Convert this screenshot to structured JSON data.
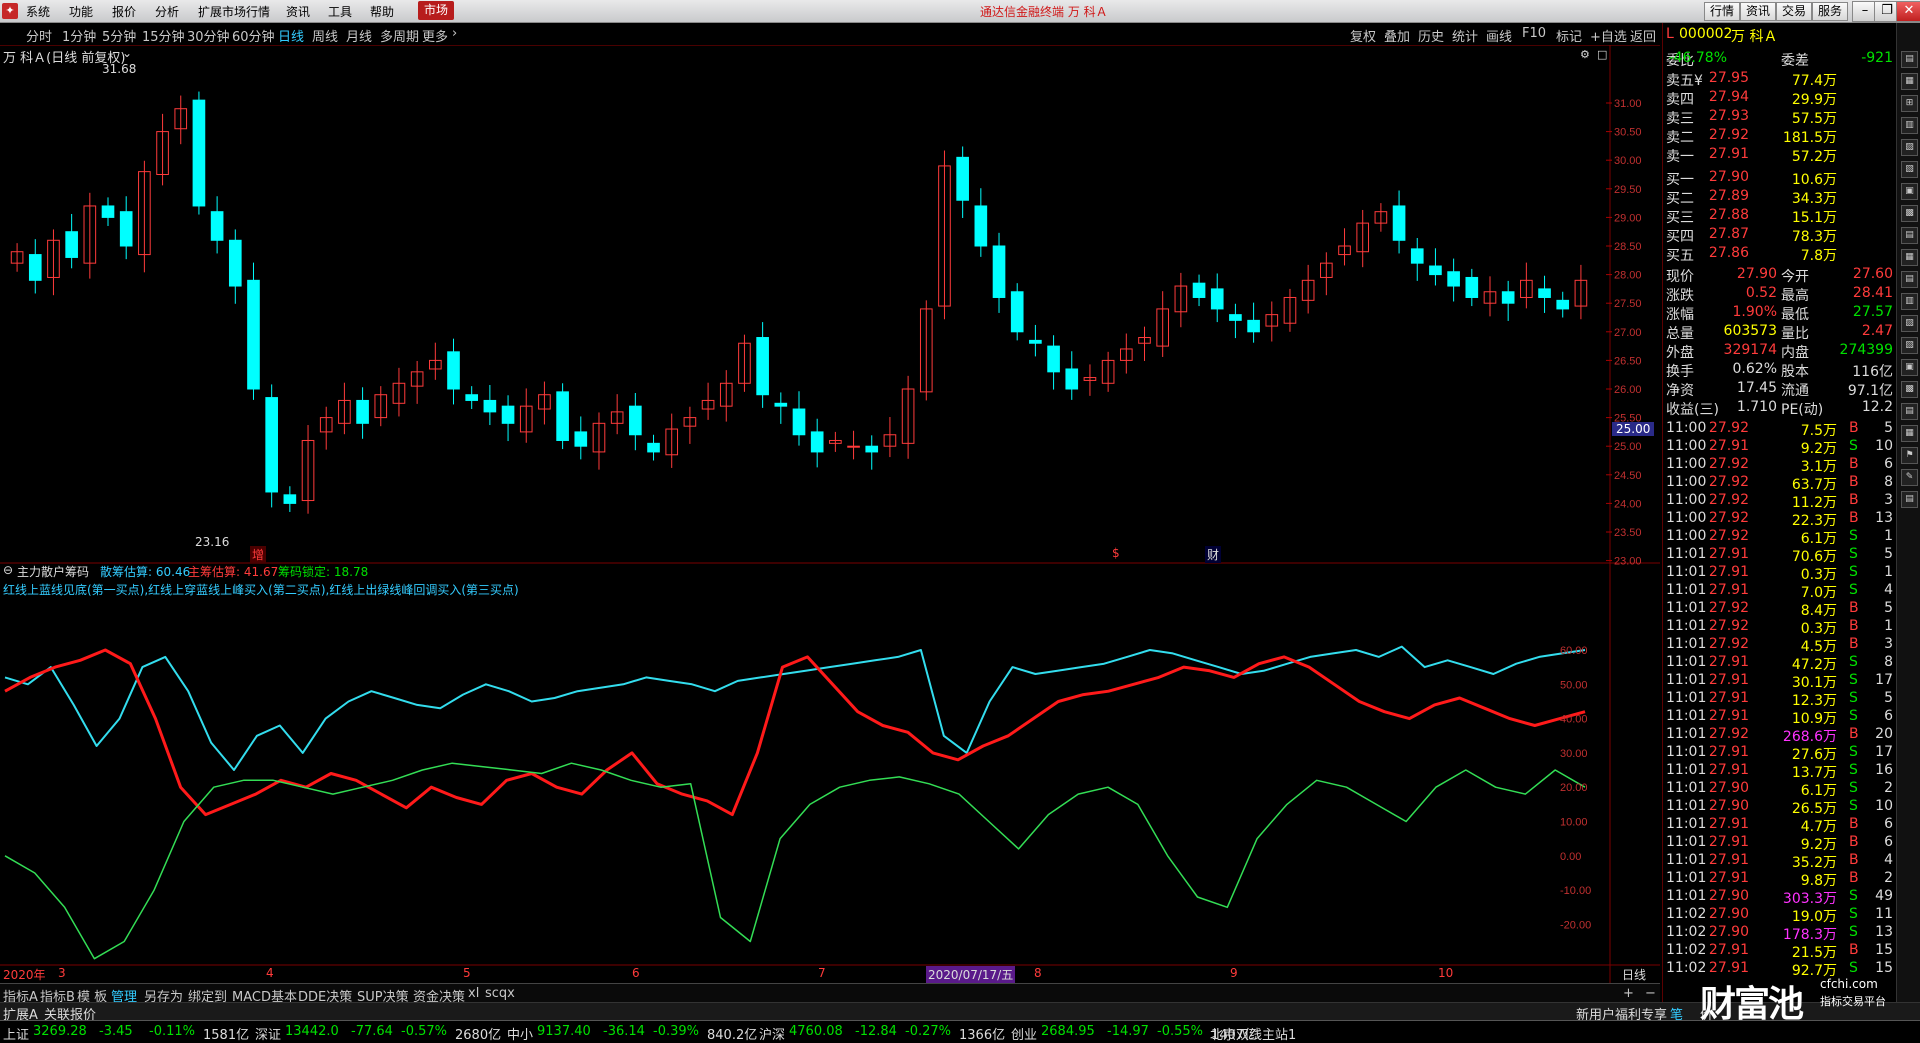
{
  "menu": {
    "items": [
      "系统",
      "功能",
      "报价",
      "分析",
      "扩展市场行情",
      "资讯",
      "工具",
      "帮助"
    ],
    "market": "市场",
    "app_title": "通达信金融终端 万 科Ａ",
    "top_buttons": [
      "行情",
      "资讯",
      "交易",
      "服务"
    ]
  },
  "periods": [
    "分时",
    "1分钟",
    "5分钟",
    "15分钟",
    "30分钟",
    "60分钟",
    "日线",
    "周线",
    "月线",
    "多周期",
    "更多"
  ],
  "active_period": "日线",
  "chart_tools": [
    "复权",
    "叠加",
    "历史",
    "统计",
    "画线",
    "F10",
    "标记",
    "+自选",
    "返回"
  ],
  "stock_title": "万 科Ａ(日线 前复权)",
  "price_chart": {
    "high_mark": "31.68",
    "low_mark": "23.16",
    "y_labels": [
      "31.00",
      "30.50",
      "30.00",
      "29.50",
      "29.00",
      "28.50",
      "28.00",
      "27.50",
      "27.00",
      "26.50",
      "26.00",
      "25.50",
      "25.00",
      "24.50",
      "24.00",
      "23.50",
      "23.00"
    ],
    "current_price_label": "25.00",
    "event_marks": [
      "增",
      "$",
      "财"
    ]
  },
  "indicator": {
    "name": "主力散户筹码",
    "retail_label": "散筹估算: 60.46",
    "main_label": "主筹估算: 41.67",
    "lock_label": "筹码锁定: 18.78",
    "note": "红线上蓝线见底(第一买点),红线上穿蓝线上峰买入(第二买点),红线上出绿线峰回调买入(第三买点)",
    "y_labels": [
      "60.00",
      "50.00",
      "40.00",
      "30.00",
      "20.00",
      "10.00",
      "0.00",
      "-10.00",
      "-20.00"
    ]
  },
  "x_axis": {
    "labels": [
      "2020年",
      "3",
      "4",
      "5",
      "6",
      "7",
      "8",
      "9",
      "10"
    ],
    "cursor_date": "2020/07/17/五",
    "scale_label": "日线"
  },
  "colors": {
    "up": "#ff3b3b",
    "down": "#00ffff",
    "retail_line": "#33ddee",
    "main_line": "#ff1a1a",
    "lock_line": "#33dd55"
  },
  "chart_data": [
    {
      "type": "candlestick",
      "title": "万 科Ａ(日线 前复权)",
      "ylim": [
        23.0,
        31.3
      ],
      "high": 31.68,
      "low": 23.16,
      "series": [
        {
          "name": "万 科Ａ",
          "values": [
            28.4,
            27.9,
            28.6,
            28.3,
            29.2,
            29.0,
            28.5,
            29.8,
            30.5,
            30.9,
            29.2,
            28.6,
            27.8,
            26.0,
            24.2,
            24.0,
            25.1,
            25.5,
            25.8,
            25.4,
            25.9,
            26.1,
            26.3,
            26.5,
            26.0,
            25.8,
            25.6,
            25.4,
            25.7,
            25.9,
            25.1,
            25.0,
            25.4,
            25.6,
            25.2,
            24.9,
            25.3,
            25.5,
            25.8,
            26.1,
            26.8,
            25.9,
            25.7,
            25.2,
            24.9,
            25.1,
            25.0,
            24.9,
            25.2,
            26.0,
            27.4,
            29.9,
            29.3,
            28.5,
            27.6,
            27.0,
            26.8,
            26.3,
            26.0,
            26.2,
            26.5,
            26.7,
            26.9,
            27.4,
            27.8,
            27.6,
            27.4,
            27.2,
            27.0,
            27.3,
            27.6,
            27.9,
            28.2,
            28.5,
            28.9,
            29.1,
            28.6,
            28.2,
            28.0,
            27.8,
            27.6,
            27.7,
            27.5,
            27.9,
            27.6,
            27.4,
            27.9
          ]
        }
      ]
    },
    {
      "type": "line",
      "title": "主力散户筹码",
      "ylim": [
        -35,
        65
      ],
      "series": [
        {
          "name": "散筹估算",
          "values": [
            52,
            50,
            55,
            44,
            32,
            40,
            55,
            58,
            48,
            33,
            25,
            35,
            38,
            30,
            40,
            45,
            48,
            46,
            44,
            43,
            47,
            50,
            48,
            45,
            46,
            48,
            49,
            50,
            52,
            51,
            50,
            48,
            51,
            52,
            53,
            54,
            55,
            56,
            57,
            58,
            60,
            35,
            30,
            45,
            55,
            53,
            54,
            55,
            56,
            58,
            60,
            59,
            57,
            55,
            53,
            54,
            56,
            58,
            59,
            60,
            58,
            61,
            55,
            57,
            55,
            53,
            56,
            58,
            59,
            60
          ]
        },
        {
          "name": "主筹估算",
          "values": [
            48,
            52,
            55,
            57,
            60,
            56,
            40,
            20,
            12,
            15,
            18,
            22,
            20,
            24,
            22,
            18,
            14,
            20,
            17,
            15,
            22,
            24,
            20,
            18,
            25,
            30,
            21,
            18,
            16,
            12,
            30,
            55,
            58,
            50,
            42,
            38,
            36,
            30,
            28,
            32,
            35,
            40,
            45,
            47,
            48,
            50,
            52,
            55,
            54,
            52,
            56,
            58,
            55,
            50,
            45,
            42,
            40,
            44,
            46,
            43,
            40,
            38,
            40,
            42
          ]
        },
        {
          "name": "筹码锁定",
          "values": [
            0,
            -5,
            -15,
            -30,
            -25,
            -10,
            10,
            20,
            22,
            22,
            20,
            18,
            20,
            22,
            25,
            27,
            26,
            25,
            24,
            27,
            25,
            22,
            20,
            21,
            -18,
            -25,
            5,
            15,
            20,
            22,
            23,
            21,
            18,
            10,
            2,
            12,
            18,
            20,
            15,
            0,
            -12,
            -15,
            5,
            15,
            22,
            20,
            15,
            10,
            20,
            25,
            20,
            18,
            25,
            20
          ]
        }
      ]
    }
  ],
  "quote": {
    "code": "000002",
    "name": "万 科Ａ",
    "ratio_label": "委比",
    "ratio_value": "-46.78%",
    "diff_label": "委差",
    "diff_value": "-921",
    "sell": [
      {
        "label": "卖五",
        "price": "27.95",
        "vol": "77.4万",
        "suffix": "¥"
      },
      {
        "label": "卖四",
        "price": "27.94",
        "vol": "29.9万"
      },
      {
        "label": "卖三",
        "price": "27.93",
        "vol": "57.5万"
      },
      {
        "label": "卖二",
        "price": "27.92",
        "vol": "181.5万"
      },
      {
        "label": "卖一",
        "price": "27.91",
        "vol": "57.2万"
      }
    ],
    "buy": [
      {
        "label": "买一",
        "price": "27.90",
        "vol": "10.6万"
      },
      {
        "label": "买二",
        "price": "27.89",
        "vol": "34.3万"
      },
      {
        "label": "买三",
        "price": "27.88",
        "vol": "15.1万"
      },
      {
        "label": "买四",
        "price": "27.87",
        "vol": "78.3万"
      },
      {
        "label": "买五",
        "price": "27.86",
        "vol": "7.8万"
      }
    ],
    "stats": [
      {
        "l1": "现价",
        "v1": "27.90",
        "l2": "今开",
        "v2": "27.60",
        "c1": "up",
        "c2": "up"
      },
      {
        "l1": "涨跌",
        "v1": "0.52",
        "l2": "最高",
        "v2": "28.41",
        "c1": "up",
        "c2": "up"
      },
      {
        "l1": "涨幅",
        "v1": "1.90%",
        "l2": "最低",
        "v2": "27.57",
        "c1": "up",
        "c2": "dn"
      },
      {
        "l1": "总量",
        "v1": "603573",
        "l2": "量比",
        "v2": "2.47",
        "c1": "yl",
        "c2": "up"
      },
      {
        "l1": "外盘",
        "v1": "329174",
        "l2": "内盘",
        "v2": "274399",
        "c1": "up",
        "c2": "dn"
      },
      {
        "l1": "换手",
        "v1": "0.62%",
        "l2": "股本",
        "v2": "116亿",
        "c1": "wh",
        "c2": "wh"
      },
      {
        "l1": "净资",
        "v1": "17.45",
        "l2": "流通",
        "v2": "97.1亿",
        "c1": "wh",
        "c2": "wh"
      },
      {
        "l1": "收益(三)",
        "v1": "1.710",
        "l2": "PE(动)",
        "v2": "12.2",
        "c1": "wh",
        "c2": "wh"
      }
    ],
    "ticks": [
      {
        "t": "11:00",
        "p": "27.92",
        "v": "7.5万",
        "d": "B",
        "n": "5"
      },
      {
        "t": "11:00",
        "p": "27.91",
        "v": "9.2万",
        "d": "S",
        "n": "10"
      },
      {
        "t": "11:00",
        "p": "27.92",
        "v": "3.1万",
        "d": "B",
        "n": "6"
      },
      {
        "t": "11:00",
        "p": "27.92",
        "v": "63.7万",
        "d": "B",
        "n": "8"
      },
      {
        "t": "11:00",
        "p": "27.92",
        "v": "11.2万",
        "d": "B",
        "n": "3"
      },
      {
        "t": "11:00",
        "p": "27.92",
        "v": "22.3万",
        "d": "B",
        "n": "13"
      },
      {
        "t": "11:00",
        "p": "27.92",
        "v": "6.1万",
        "d": "S",
        "n": "1"
      },
      {
        "t": "11:01",
        "p": "27.91",
        "v": "70.6万",
        "d": "S",
        "n": "5"
      },
      {
        "t": "11:01",
        "p": "27.91",
        "v": "0.3万",
        "d": "S",
        "n": "1"
      },
      {
        "t": "11:01",
        "p": "27.91",
        "v": "7.0万",
        "d": "S",
        "n": "4"
      },
      {
        "t": "11:01",
        "p": "27.92",
        "v": "8.4万",
        "d": "B",
        "n": "5"
      },
      {
        "t": "11:01",
        "p": "27.92",
        "v": "0.3万",
        "d": "B",
        "n": "1"
      },
      {
        "t": "11:01",
        "p": "27.92",
        "v": "4.5万",
        "d": "B",
        "n": "3"
      },
      {
        "t": "11:01",
        "p": "27.91",
        "v": "47.2万",
        "d": "S",
        "n": "8"
      },
      {
        "t": "11:01",
        "p": "27.91",
        "v": "30.1万",
        "d": "S",
        "n": "17"
      },
      {
        "t": "11:01",
        "p": "27.91",
        "v": "12.3万",
        "d": "S",
        "n": "5"
      },
      {
        "t": "11:01",
        "p": "27.91",
        "v": "10.9万",
        "d": "S",
        "n": "6"
      },
      {
        "t": "11:01",
        "p": "27.92",
        "v": "268.6万",
        "d": "B",
        "n": "20",
        "big": true
      },
      {
        "t": "11:01",
        "p": "27.91",
        "v": "27.6万",
        "d": "S",
        "n": "17"
      },
      {
        "t": "11:01",
        "p": "27.91",
        "v": "13.7万",
        "d": "S",
        "n": "16"
      },
      {
        "t": "11:01",
        "p": "27.90",
        "v": "6.1万",
        "d": "S",
        "n": "2"
      },
      {
        "t": "11:01",
        "p": "27.90",
        "v": "26.5万",
        "d": "S",
        "n": "10"
      },
      {
        "t": "11:01",
        "p": "27.91",
        "v": "4.7万",
        "d": "B",
        "n": "6"
      },
      {
        "t": "11:01",
        "p": "27.91",
        "v": "9.2万",
        "d": "B",
        "n": "6"
      },
      {
        "t": "11:01",
        "p": "27.91",
        "v": "35.2万",
        "d": "B",
        "n": "4"
      },
      {
        "t": "11:01",
        "p": "27.91",
        "v": "9.8万",
        "d": "B",
        "n": "2"
      },
      {
        "t": "11:01",
        "p": "27.90",
        "v": "303.3万",
        "d": "S",
        "n": "49",
        "big": true
      },
      {
        "t": "11:02",
        "p": "27.90",
        "v": "19.0万",
        "d": "S",
        "n": "11"
      },
      {
        "t": "11:02",
        "p": "27.90",
        "v": "178.3万",
        "d": "S",
        "n": "13",
        "big": true
      },
      {
        "t": "11:02",
        "p": "27.91",
        "v": "21.5万",
        "d": "B",
        "n": "15"
      },
      {
        "t": "11:02",
        "p": "27.91",
        "v": "92.7万",
        "d": "S",
        "n": "15"
      }
    ]
  },
  "bottom_tabs": [
    "指标A",
    "指标B",
    "模 板",
    "管理",
    "另存为",
    "绑定到",
    "MACD基本",
    "DDE决策",
    "SUP决策",
    "资金决策",
    "xl",
    "scqx"
  ],
  "active_tab": "管理",
  "bar2": {
    "left1": "扩展A",
    "left2": "关联报价",
    "right": "新用户福利专享",
    "right2": "笔",
    "right3": "价"
  },
  "status": [
    {
      "name": "上证",
      "value": "3269.28",
      "chg": "-3.45",
      "pct": "-0.11%",
      "amt": "1581亿"
    },
    {
      "name": "深证",
      "value": "13442.0",
      "chg": "-77.64",
      "pct": "-0.57%",
      "amt": "2680亿"
    },
    {
      "name": "中小",
      "value": "9137.40",
      "chg": "-36.14",
      "pct": "-0.39%",
      "amt": "840.2亿"
    },
    {
      "name": "沪深",
      "value": "4760.08",
      "chg": "-12.84",
      "pct": "-0.27%",
      "amt": "1366亿"
    },
    {
      "name": "创业",
      "value": "2684.95",
      "chg": "-14.97",
      "pct": "-0.55%",
      "amt": "1407亿"
    }
  ],
  "server": "北京双线主站1",
  "watermark": {
    "main": "财富池",
    "sub": "cfchi.com",
    "sub2": "指标交易平台"
  }
}
